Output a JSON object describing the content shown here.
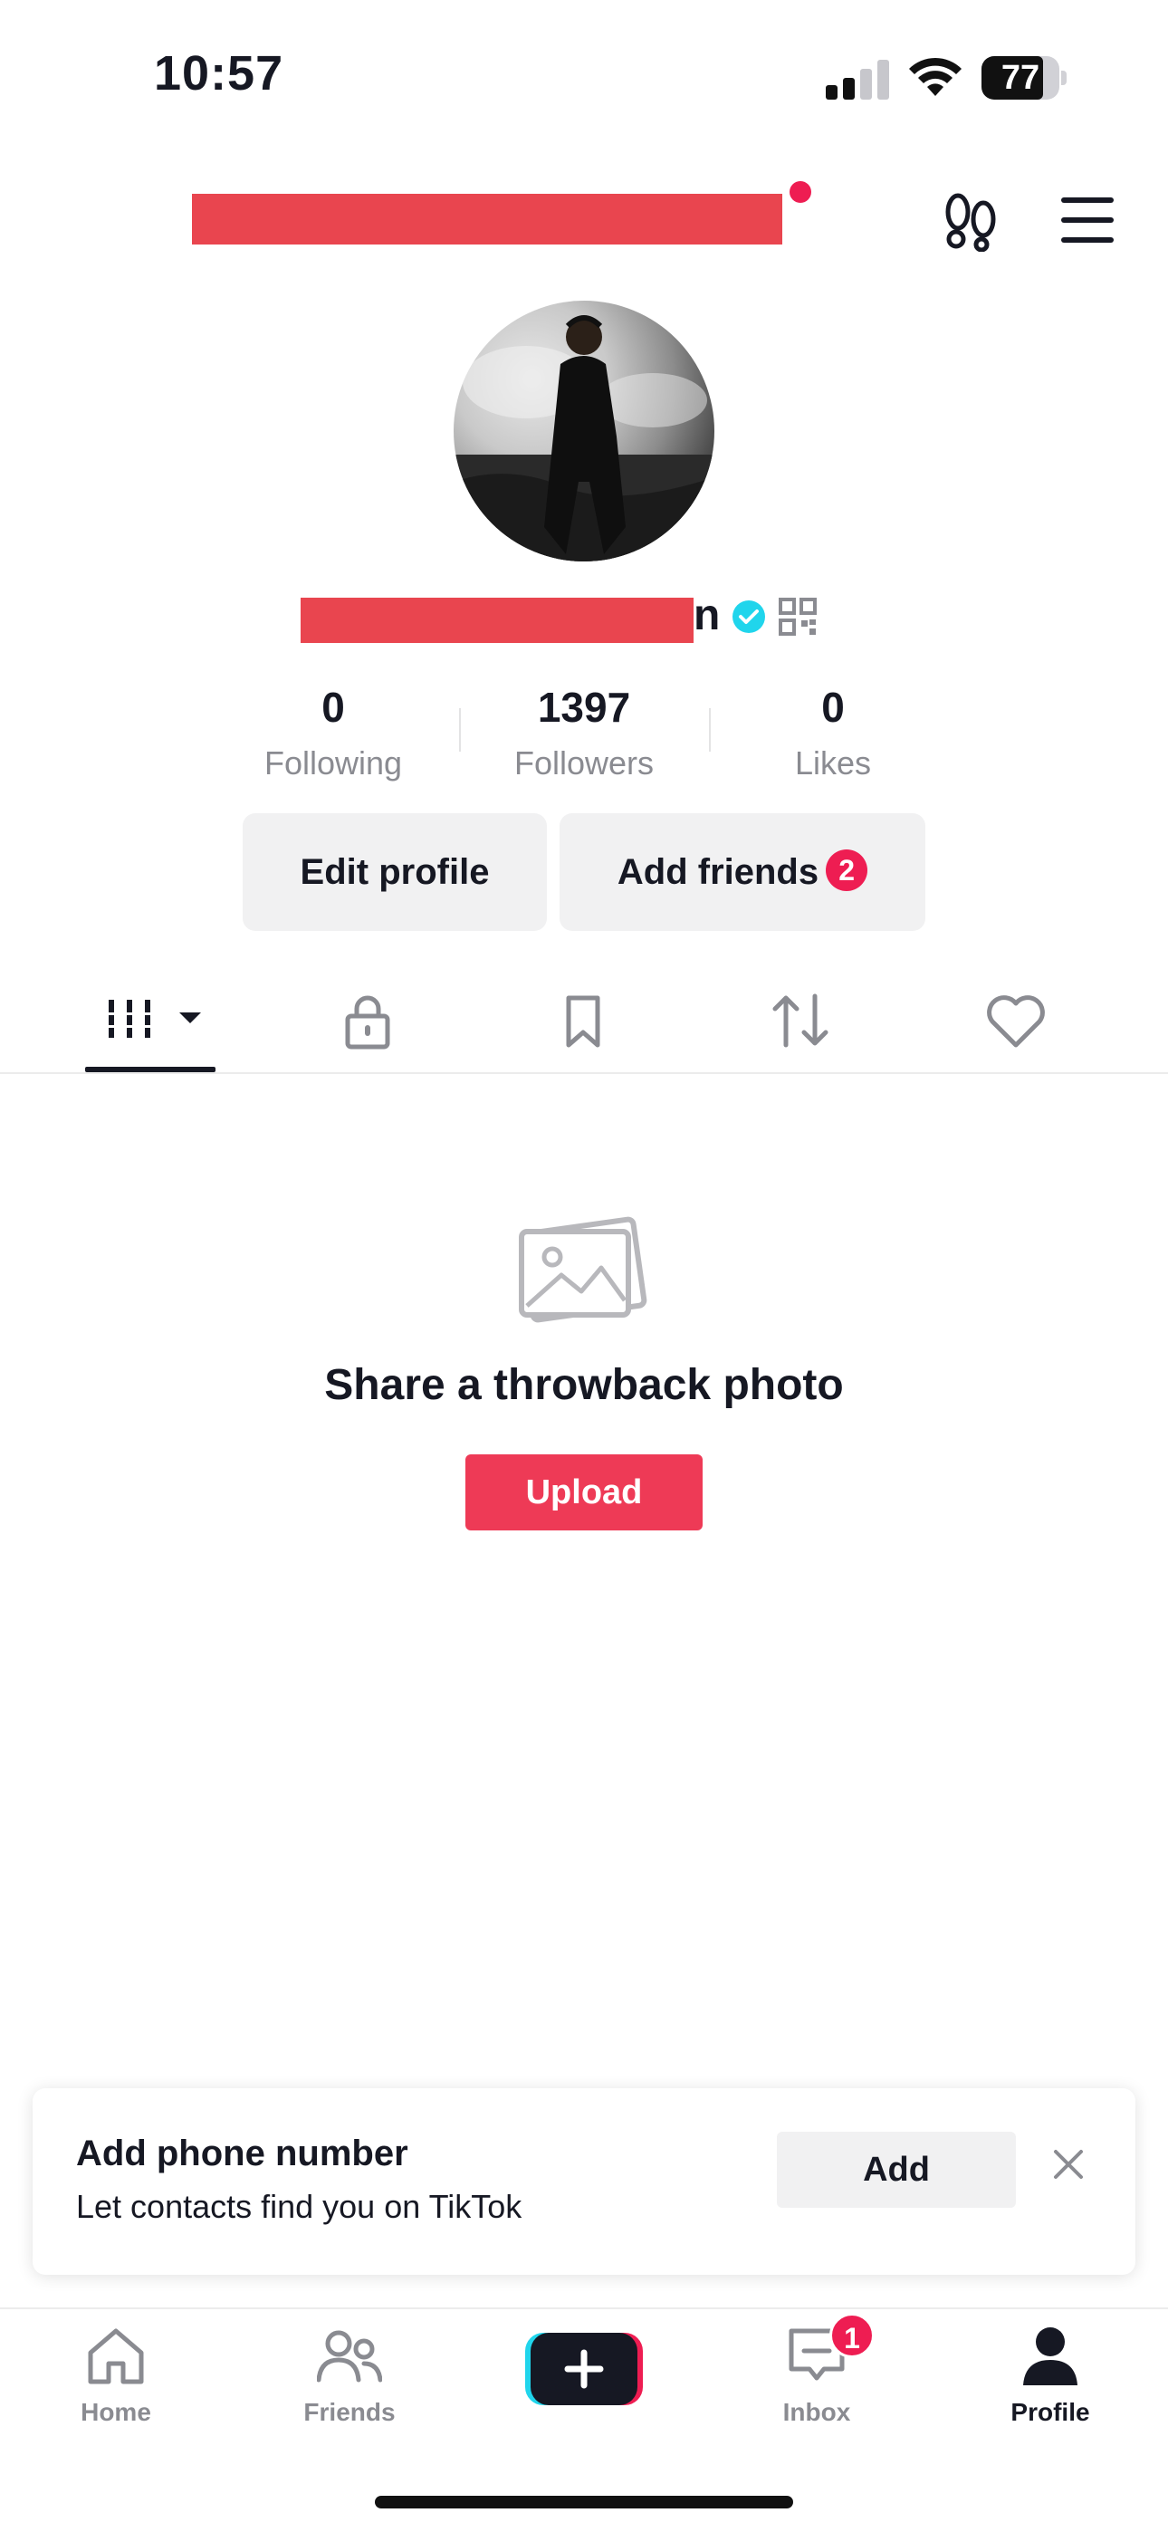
{
  "status_bar": {
    "time": "10:57",
    "battery": "77"
  },
  "profile": {
    "username_visible_tail": "n",
    "stats": [
      {
        "value": "0",
        "label": "Following"
      },
      {
        "value": "1397",
        "label": "Followers"
      },
      {
        "value": "0",
        "label": "Likes"
      }
    ],
    "edit_profile_label": "Edit profile",
    "add_friends_label": "Add friends",
    "add_friends_badge": "2"
  },
  "tabs": [
    "videos-grid",
    "private",
    "favorites",
    "reposts",
    "liked"
  ],
  "empty_state": {
    "title": "Share a throwback photo",
    "button": "Upload"
  },
  "phone_card": {
    "title": "Add phone number",
    "subtitle": "Let contacts find you on TikTok",
    "button": "Add"
  },
  "nav": {
    "home": "Home",
    "friends": "Friends",
    "inbox": "Inbox",
    "inbox_badge": "1",
    "profile": "Profile"
  },
  "colors": {
    "accent": "#ee1d52",
    "redaction": "#e9454f",
    "verified": "#20d5ec"
  }
}
